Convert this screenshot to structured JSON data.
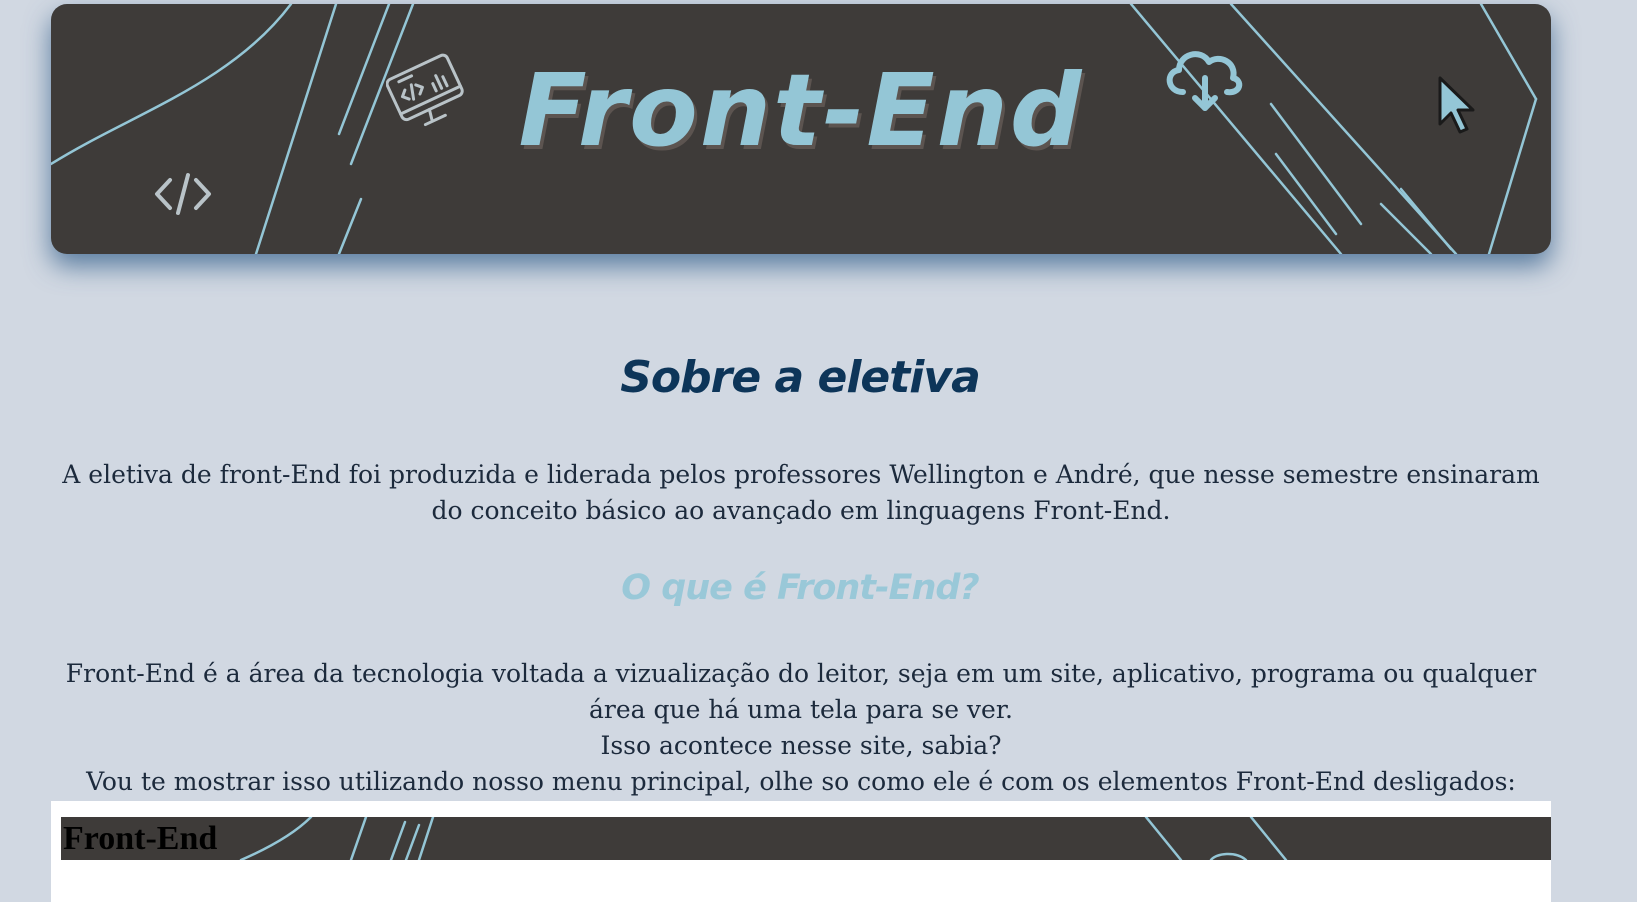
{
  "banner": {
    "title": "Front-End",
    "icons": [
      "code-icon",
      "monitor-code-icon",
      "cloud-download-icon",
      "cursor-icon"
    ]
  },
  "about": {
    "heading": "Sobre a eletiva",
    "text": "A eletiva de front-End foi produzida e liderada pelos professores Wellington e André, que nesse semestre ensinaram do conceito básico ao avançado em linguagens Front-End."
  },
  "what_is": {
    "heading": "O que é Front-End?",
    "line1": "Front-End é a área da tecnologia voltada a vizualização do leitor, seja em um site, aplicativo, programa ou qualquer área que há uma tela para se ver.",
    "line2": "Isso acontece nesse site, sabia?",
    "line3": "Vou te mostrar isso utilizando nosso menu principal, olhe so como ele é com os elementos Front-End desligados:"
  },
  "demo": {
    "title": "Front-End"
  },
  "colors": {
    "page_background": "#d1d8e2",
    "banner_background": "#3e3b39",
    "accent_light_blue": "#94c6d6",
    "heading_dark_blue": "#0d3559",
    "text": "#1c2a3c"
  }
}
